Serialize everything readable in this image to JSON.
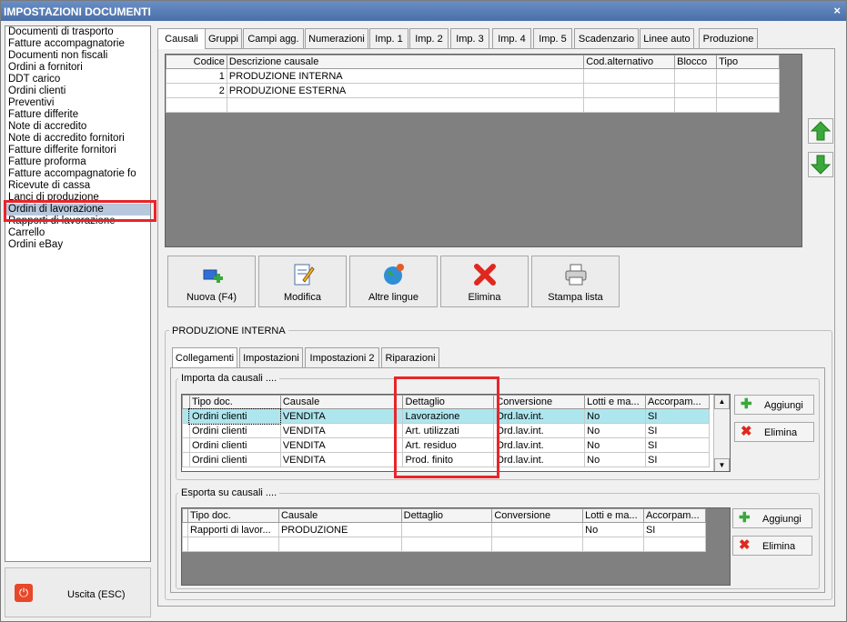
{
  "window": {
    "title": "IMPOSTAZIONI DOCUMENTI",
    "close_glyph": "×"
  },
  "sidebar": {
    "items": [
      "Documenti di trasporto",
      "Fatture accompagnatorie",
      "Documenti non fiscali",
      "Ordini a fornitori",
      "DDT carico",
      "Ordini clienti",
      "Preventivi",
      "Fatture differite",
      "Note di accredito",
      "Note di accredito fornitori",
      "Fatture differite fornitori",
      "Fatture proforma",
      "Fatture accompagnatorie fo",
      "Ricevute di cassa",
      "Lanci di produzione",
      "Ordini di lavorazione",
      "Rapporti di lavorazione",
      "Carrello",
      "Ordini eBay"
    ],
    "selected_index": 15
  },
  "exit": {
    "label": "Uscita (ESC)"
  },
  "tabs": [
    "Causali",
    "Gruppi",
    "Campi agg.",
    "Numerazioni",
    "Imp. 1",
    "Imp. 2",
    "Imp. 3",
    "Imp. 4",
    "Imp. 5",
    "Scadenzario",
    "Linee auto",
    "Produzione"
  ],
  "causali_table": {
    "headers": [
      "Codice",
      "Descrizione causale",
      "Cod.alternativo",
      "Blocco",
      "Tipo"
    ],
    "rows": [
      [
        "1",
        "PRODUZIONE INTERNA",
        "",
        "",
        ""
      ],
      [
        "2",
        "PRODUZIONE ESTERNA",
        "",
        "",
        ""
      ]
    ]
  },
  "toolbar": {
    "nuova": "Nuova (F4)",
    "modifica": "Modifica",
    "lingue": "Altre lingue",
    "elimina": "Elimina",
    "stampa": "Stampa lista"
  },
  "section": {
    "title": "PRODUZIONE INTERNA"
  },
  "subtabs": [
    "Collegamenti",
    "Impostazioni",
    "Impostazioni 2",
    "Riparazioni"
  ],
  "importa": {
    "title": "Importa da causali ....",
    "headers": [
      "Tipo doc.",
      "Causale",
      "Dettaglio",
      "Conversione",
      "Lotti e ma...",
      "Accorpam..."
    ],
    "rows": [
      [
        "Ordini clienti",
        "VENDITA",
        "Lavorazione",
        "Ord.lav.int.",
        "No",
        "SI"
      ],
      [
        "Ordini clienti",
        "VENDITA",
        "Art. utilizzati",
        "Ord.lav.int.",
        "No",
        "SI"
      ],
      [
        "Ordini clienti",
        "VENDITA",
        "Art. residuo",
        "Ord.lav.int.",
        "No",
        "SI"
      ],
      [
        "Ordini clienti",
        "VENDITA",
        "Prod. finito",
        "Ord.lav.int.",
        "No",
        "SI"
      ]
    ],
    "aggiungi": "Aggiungi",
    "elimina": "Elimina"
  },
  "esporta": {
    "title": "Esporta su causali ....",
    "headers": [
      "Tipo doc.",
      "Causale",
      "Dettaglio",
      "Conversione",
      "Lotti e ma...",
      "Accorpam..."
    ],
    "rows": [
      [
        "Rapporti di lavor...",
        "PRODUZIONE",
        "",
        "",
        "No",
        "SI"
      ]
    ],
    "aggiungi": "Aggiungi",
    "elimina": "Elimina"
  },
  "colors": {
    "accent_green": "#3aa83a",
    "delete_red": "#e0281e",
    "highlight_red": "#e8252a",
    "selected_row": "#aee6ee"
  }
}
